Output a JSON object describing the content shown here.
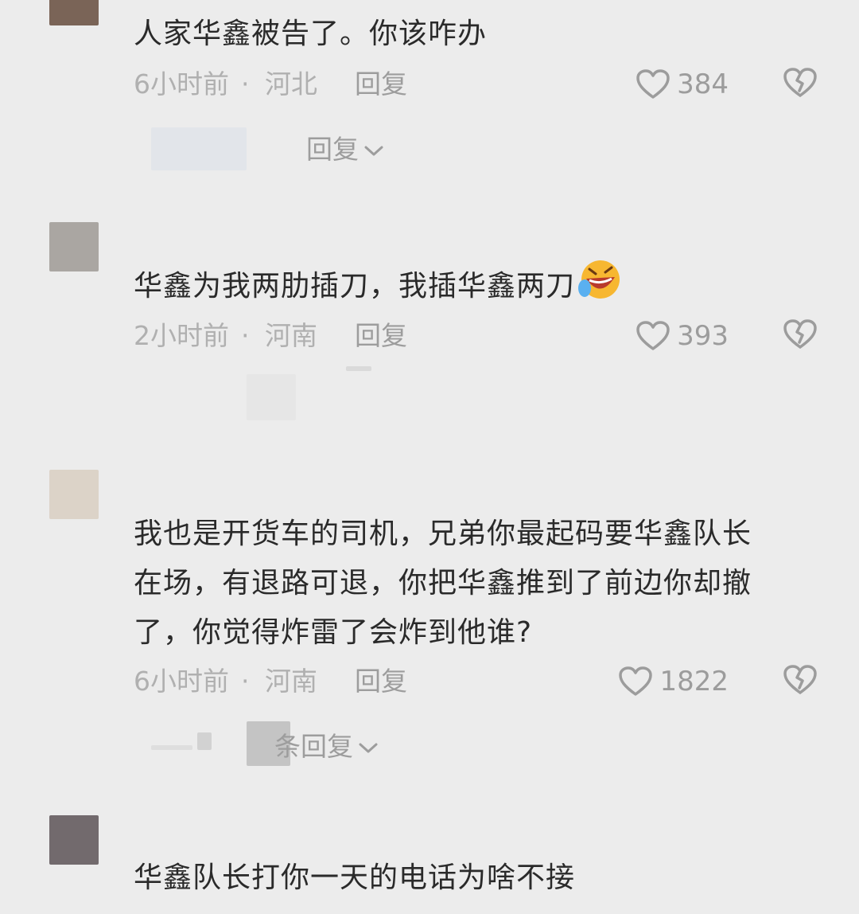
{
  "comments": [
    {
      "text": "人家华鑫被告了。你该咋办",
      "time": "6小时前",
      "separator": "·",
      "location": "河北",
      "reply_label": "回复",
      "likes": "384",
      "replies_toggle": "回复",
      "avatar_color": "#7a6457"
    },
    {
      "text": "华鑫为我两肋插刀，我插华鑫两刀",
      "emoji": "laughing-crying-emoji",
      "time": "2小时前",
      "separator": "·",
      "location": "河南",
      "reply_label": "回复",
      "likes": "393",
      "avatar_color": "#aaa6a2"
    },
    {
      "text_lines": [
        "我也是开货车的司机，兄弟你最起码要华鑫队长",
        "在场，有退路可退，你把华鑫推到了前边你却撤",
        "了，你觉得炸雷了会炸到他谁?"
      ],
      "time": "6小时前",
      "separator": "·",
      "location": "河南",
      "reply_label": "回复",
      "likes": "1822",
      "replies_toggle": "条回复",
      "avatar_color": "#dcd3c8"
    },
    {
      "text": "华鑫队长打你一天的电话为啥不接",
      "avatar_color": "#726a6d"
    }
  ],
  "icons": {
    "like": "heart-outline-icon",
    "dislike": "broken-heart-icon",
    "expand": "chevron-down-icon"
  },
  "colors": {
    "background": "#ececec",
    "text": "#2a2a2a",
    "meta": "#b0b0b0",
    "icon": "#9c9c9c"
  }
}
